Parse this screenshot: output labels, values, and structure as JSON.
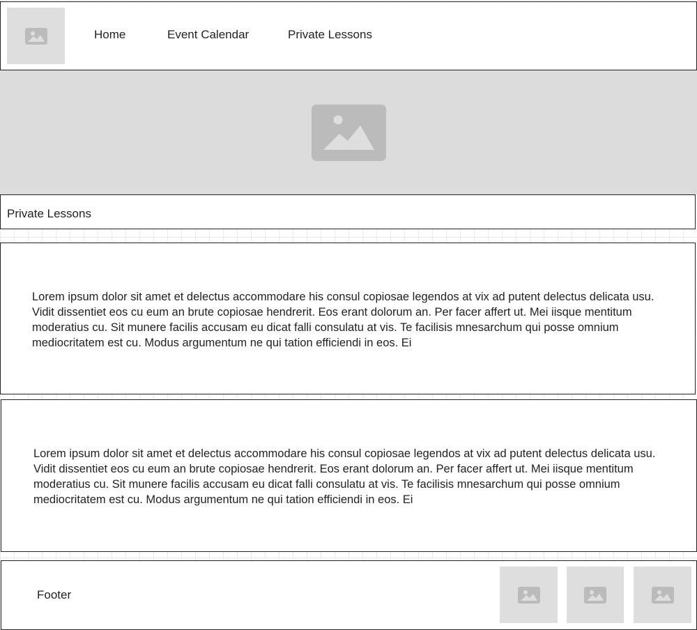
{
  "header": {
    "logo_icon": "image-placeholder-icon",
    "nav": {
      "home": "Home",
      "event_calendar": "Event Calendar",
      "private_lessons": "Private Lessons"
    }
  },
  "hero": {
    "icon": "image-placeholder-icon"
  },
  "page": {
    "title": "Private Lessons"
  },
  "content": [
    {
      "text": "Lorem ipsum dolor sit amet et delectus accommodare his consul copiosae legendos at vix ad putent delectus delicata usu. Vidit dissentiet eos cu eum an brute copiosae hendrerit. Eos erant dolorum an. Per facer affert ut. Mei iisque mentitum moderatius cu. Sit munere facilis accusam eu dicat falli consulatu at vis. Te facilisis mnesarchum qui posse omnium mediocritatem est cu. Modus argumentum ne qui tation efficiendi in eos. Ei"
    },
    {
      "text": "Lorem ipsum dolor sit amet et delectus accommodare his consul copiosae legendos at vix ad putent delectus delicata usu. Vidit dissentiet eos cu eum an brute copiosae hendrerit. Eos erant dolorum an. Per facer affert ut. Mei iisque mentitum moderatius cu. Sit munere facilis accusam eu dicat falli consulatu at vis. Te facilisis mnesarchum qui posse omnium mediocritatem est cu. Modus argumentum ne qui tation efficiendi in eos. Ei"
    }
  ],
  "footer": {
    "label": "Footer",
    "images": [
      "image-placeholder-icon",
      "image-placeholder-icon",
      "image-placeholder-icon"
    ]
  },
  "colors": {
    "placeholder_bg": "#dedede",
    "placeholder_icon": "#bbbbbb",
    "border": "#222222",
    "text": "#222222"
  }
}
